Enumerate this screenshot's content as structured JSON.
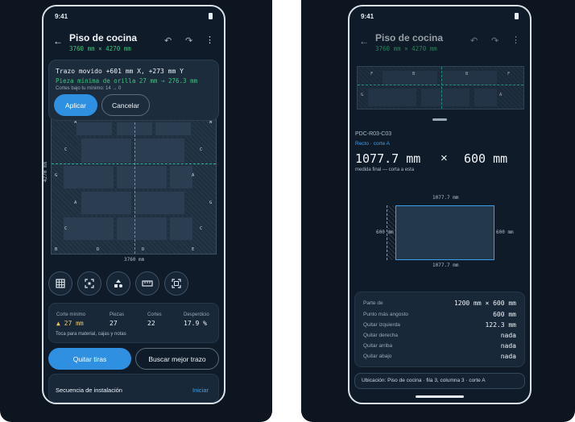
{
  "status": {
    "time": "9:41"
  },
  "header": {
    "title": "Piso de cocina",
    "subtitle": "3760 mm × 4270 mm"
  },
  "toast": {
    "line1": "Trazo movido +601 mm X, +273 mm Y",
    "line2": "Pieza mínima de orilla 27 mm → 276.3 mm",
    "line3": "Cortes bajo tu mínimo: 14 → 0",
    "apply_label": "Aplicar",
    "cancel_label": "Cancelar"
  },
  "plan": {
    "width_label": "3760 mm",
    "height_label": "4270 mm",
    "labels": [
      "A",
      "W",
      "C",
      "C",
      "G",
      "A",
      "A",
      "G",
      "C",
      "C",
      "B",
      "D",
      "D",
      "E"
    ]
  },
  "stats": {
    "min_cut_label": "Corte mínimo",
    "min_cut_value": "▲ 27 mm",
    "pieces_label": "Piezas",
    "pieces_value": "27",
    "cuts_label": "Cortes",
    "cuts_value": "22",
    "waste_label": "Desperdicio",
    "waste_value": "17.9 %",
    "hint": "Toca para material, cajas y notas"
  },
  "actions": {
    "remove_strips": "Quitar tiras",
    "find_best": "Buscar mejor trazo"
  },
  "sequence": {
    "label": "Secuencia de instalación",
    "action": "Iniciar"
  },
  "right": {
    "mini_labels": [
      "F",
      "B",
      "B",
      "F",
      "G",
      "A"
    ],
    "piece_id": "PDC-R03-C03",
    "piece_type": "Recto · corte A",
    "dims": "1077.7 mm",
    "times": "×",
    "dims2": "600 mm",
    "dims_note": "medida final — corta a esta",
    "diagram": {
      "top": "1077.7 mm",
      "bottom": "1077.7 mm",
      "left": "600 mm",
      "right": "600 mm"
    },
    "details": [
      {
        "label": "Parte de",
        "value": "1200 mm × 600 mm"
      },
      {
        "label": "Punto más angosto",
        "value": "600 mm"
      },
      {
        "label": "Quitar izquierda",
        "value": "122.3 mm"
      },
      {
        "label": "Quitar derecha",
        "value": "nada"
      },
      {
        "label": "Quitar arriba",
        "value": "nada"
      },
      {
        "label": "Quitar abajo",
        "value": "nada"
      }
    ],
    "location": "Ubicación: Piso de cocina · fila 3, columna 3 · corte A"
  }
}
